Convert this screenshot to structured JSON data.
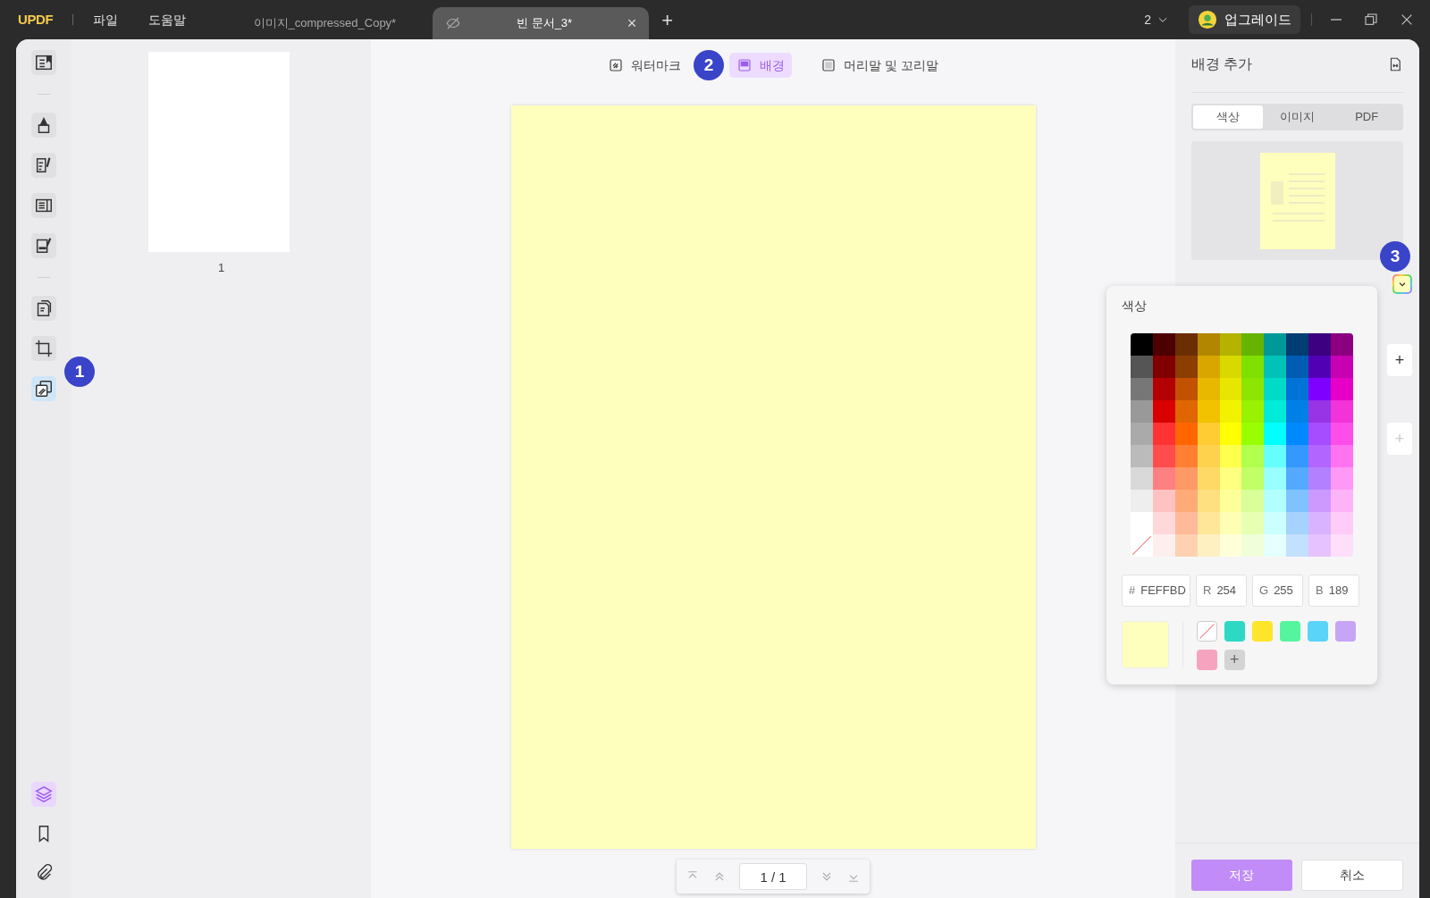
{
  "title_bar": {
    "logo": "UPDF",
    "menus": [
      "파일",
      "도움말"
    ],
    "tabs": [
      {
        "label": "이미지_compressed_Copy*",
        "selected": false
      },
      {
        "label": "빈 문서_3*",
        "selected": true,
        "close": "×"
      }
    ],
    "new_tab": "+",
    "page_count": "2",
    "upgrade": "업그레이드"
  },
  "tool_rail": {
    "items": [
      {
        "kind": "reader",
        "selected": false
      },
      {
        "kind": "divider"
      },
      {
        "kind": "highlight",
        "selected": false
      },
      {
        "kind": "edit",
        "selected": false
      },
      {
        "kind": "form",
        "selected": false
      },
      {
        "kind": "sign",
        "selected": false
      },
      {
        "kind": "divider"
      },
      {
        "kind": "pages",
        "selected": false
      },
      {
        "kind": "crop",
        "selected": false
      },
      {
        "kind": "background",
        "selected": true
      }
    ],
    "bottom": [
      {
        "kind": "layers",
        "selected": true
      },
      {
        "kind": "bookmark",
        "selected": false
      },
      {
        "kind": "attachment",
        "selected": false
      }
    ]
  },
  "thumbnails": [
    {
      "label": "1"
    }
  ],
  "toolbar": [
    {
      "kind": "watermark",
      "label": "워터마크",
      "selected": false
    },
    {
      "kind": "background",
      "label": "배경",
      "selected": true
    },
    {
      "kind": "header",
      "label": "머리말 및 꼬리말",
      "selected": false
    }
  ],
  "pager": {
    "value": "1 / 1"
  },
  "panel": {
    "title": "배경 추가",
    "tabs": [
      {
        "label": "색상",
        "selected": true
      },
      {
        "label": "이미지",
        "selected": false
      },
      {
        "label": "PDF",
        "selected": false
      }
    ],
    "add_buttons": [
      {
        "label": "+",
        "disabled": false
      },
      {
        "label": "+",
        "disabled": true
      }
    ],
    "save": "저장",
    "cancel": "취소"
  },
  "color_popup": {
    "title": "색상",
    "palette": [
      {
        "swatches": [
          {
            "kind": "color",
            "color": "#000000"
          },
          {
            "kind": "color",
            "color": "#4d0000"
          },
          {
            "kind": "color",
            "color": "#6b2e00"
          },
          {
            "kind": "color",
            "color": "#b38600"
          },
          {
            "kind": "color",
            "color": "#b3b300"
          },
          {
            "kind": "color",
            "color": "#66b300"
          },
          {
            "kind": "color",
            "color": "#009999"
          },
          {
            "kind": "color",
            "color": "#003d73"
          },
          {
            "kind": "color",
            "color": "#3d0080"
          },
          {
            "kind": "color",
            "color": "#8c0080"
          }
        ]
      },
      {
        "swatches": [
          {
            "kind": "color",
            "color": "#555555"
          },
          {
            "kind": "color",
            "color": "#800000"
          },
          {
            "kind": "color",
            "color": "#8c3d00"
          },
          {
            "kind": "color",
            "color": "#d9a600"
          },
          {
            "kind": "color",
            "color": "#d9d900"
          },
          {
            "kind": "color",
            "color": "#80e000"
          },
          {
            "kind": "color",
            "color": "#00c2b8"
          },
          {
            "kind": "color",
            "color": "#005cb3"
          },
          {
            "kind": "color",
            "color": "#5200b3"
          },
          {
            "kind": "color",
            "color": "#c700b3"
          }
        ]
      },
      {
        "swatches": [
          {
            "kind": "color",
            "color": "#777777"
          },
          {
            "kind": "color",
            "color": "#b30000"
          },
          {
            "kind": "color",
            "color": "#c25200"
          },
          {
            "kind": "color",
            "color": "#e6b800"
          },
          {
            "kind": "color",
            "color": "#e6e600"
          },
          {
            "kind": "color",
            "color": "#8ce600"
          },
          {
            "kind": "color",
            "color": "#00dbc9"
          },
          {
            "kind": "color",
            "color": "#0073d9"
          },
          {
            "kind": "color",
            "color": "#8000ff"
          },
          {
            "kind": "color",
            "color": "#e600c7"
          }
        ]
      },
      {
        "swatches": [
          {
            "kind": "color",
            "color": "#999999"
          },
          {
            "kind": "color",
            "color": "#d90000"
          },
          {
            "kind": "color",
            "color": "#e06600"
          },
          {
            "kind": "color",
            "color": "#f2c200"
          },
          {
            "kind": "color",
            "color": "#f2f200"
          },
          {
            "kind": "color",
            "color": "#99f200"
          },
          {
            "kind": "color",
            "color": "#00ebd9"
          },
          {
            "kind": "color",
            "color": "#0080e6"
          },
          {
            "kind": "color",
            "color": "#9933e6"
          },
          {
            "kind": "color",
            "color": "#f233d9"
          }
        ]
      },
      {
        "swatches": [
          {
            "kind": "color",
            "color": "#aaaaaa"
          },
          {
            "kind": "color",
            "color": "#ff3333"
          },
          {
            "kind": "color",
            "color": "#ff6600"
          },
          {
            "kind": "color",
            "color": "#ffcc33"
          },
          {
            "kind": "color",
            "color": "#ffff00"
          },
          {
            "kind": "color",
            "color": "#99ff00"
          },
          {
            "kind": "color",
            "color": "#00ffff"
          },
          {
            "kind": "color",
            "color": "#0088ff"
          },
          {
            "kind": "color",
            "color": "#a64dff"
          },
          {
            "kind": "color",
            "color": "#ff4dea"
          }
        ]
      },
      {
        "swatches": [
          {
            "kind": "color",
            "color": "#bbbbbb"
          },
          {
            "kind": "color",
            "color": "#ff4d4d"
          },
          {
            "kind": "color",
            "color": "#ff8033"
          },
          {
            "kind": "color",
            "color": "#ffd24d"
          },
          {
            "kind": "color",
            "color": "#ffff4d"
          },
          {
            "kind": "color",
            "color": "#b3ff4d"
          },
          {
            "kind": "color",
            "color": "#66ffff"
          },
          {
            "kind": "color",
            "color": "#3399ff"
          },
          {
            "kind": "color",
            "color": "#b366ff"
          },
          {
            "kind": "color",
            "color": "#ff73f0"
          }
        ]
      },
      {
        "swatches": [
          {
            "kind": "color",
            "color": "#d9d9d9"
          },
          {
            "kind": "color",
            "color": "#ff8080"
          },
          {
            "kind": "color",
            "color": "#ff9966"
          },
          {
            "kind": "color",
            "color": "#ffd966"
          },
          {
            "kind": "color",
            "color": "#ffff80"
          },
          {
            "kind": "color",
            "color": "#c2ff66"
          },
          {
            "kind": "color",
            "color": "#99ffff"
          },
          {
            "kind": "color",
            "color": "#55aaff"
          },
          {
            "kind": "color",
            "color": "#b380ff"
          },
          {
            "kind": "color",
            "color": "#ff99f5"
          }
        ]
      },
      {
        "swatches": [
          {
            "kind": "color",
            "color": "#eeeeee"
          },
          {
            "kind": "color",
            "color": "#ffc2c2"
          },
          {
            "kind": "color",
            "color": "#ffaa77"
          },
          {
            "kind": "color",
            "color": "#ffe080"
          },
          {
            "kind": "color",
            "color": "#ffff99"
          },
          {
            "kind": "color",
            "color": "#d9ff99"
          },
          {
            "kind": "color",
            "color": "#b3ffff"
          },
          {
            "kind": "color",
            "color": "#80c2ff"
          },
          {
            "kind": "color",
            "color": "#cc99ff"
          },
          {
            "kind": "color",
            "color": "#ffb3f7"
          }
        ]
      },
      {
        "swatches": [
          {
            "kind": "color",
            "color": "#ffffff"
          },
          {
            "kind": "color",
            "color": "#ffd9d9"
          },
          {
            "kind": "color",
            "color": "#ffbb99"
          },
          {
            "kind": "color",
            "color": "#ffe699"
          },
          {
            "kind": "color",
            "color": "#ffffb3"
          },
          {
            "kind": "color",
            "color": "#e6ffb3"
          },
          {
            "kind": "color",
            "color": "#ccffff"
          },
          {
            "kind": "color",
            "color": "#a6d2ff"
          },
          {
            "kind": "color",
            "color": "#d9b3ff"
          },
          {
            "kind": "color",
            "color": "#ffccf8"
          }
        ]
      },
      {
        "swatches": [
          {
            "kind": "none"
          },
          {
            "kind": "color",
            "color": "#ffeeee"
          },
          {
            "kind": "color",
            "color": "#ffd1b3"
          },
          {
            "kind": "color",
            "color": "#fff0c2"
          },
          {
            "kind": "color",
            "color": "#ffffd9"
          },
          {
            "kind": "color",
            "color": "#f0ffd9"
          },
          {
            "kind": "color",
            "color": "#e6ffff"
          },
          {
            "kind": "color",
            "color": "#c2e0ff"
          },
          {
            "kind": "color",
            "color": "#e6c2ff"
          },
          {
            "kind": "color",
            "color": "#ffdefa"
          }
        ]
      }
    ],
    "fields": [
      {
        "prefix": "#",
        "value": "FEFFBD"
      },
      {
        "prefix": "R",
        "value": "254"
      },
      {
        "prefix": "G",
        "value": "255"
      },
      {
        "prefix": "B",
        "value": "189"
      }
    ],
    "current": {
      "color": "#feffbd"
    },
    "recent": [
      {
        "kind": "none"
      },
      {
        "kind": "color",
        "color": "#2ed9c3"
      },
      {
        "kind": "color",
        "color": "#fde52a"
      },
      {
        "kind": "color",
        "color": "#55f5a0"
      },
      {
        "kind": "color",
        "color": "#5ad4f7"
      },
      {
        "kind": "color",
        "color": "#c6a5f7"
      },
      {
        "kind": "color",
        "color": "#f6a3bf"
      }
    ],
    "add": "+"
  },
  "step_markers": [
    {
      "label": "1",
      "kind": "rail"
    },
    {
      "label": "2",
      "kind": "toolbar"
    },
    {
      "label": "3",
      "kind": "color"
    }
  ]
}
